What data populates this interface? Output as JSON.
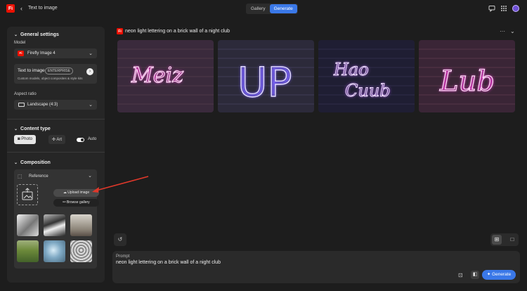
{
  "app": {
    "logo": "Fi",
    "back_glyph": "‹",
    "title": "Text to image",
    "tabs": [
      "Gallery",
      "Generate"
    ],
    "icons": [
      "chat-icon",
      "apps-grid-icon",
      "avatar"
    ]
  },
  "sidebar": {
    "general": {
      "heading": "General settings",
      "model_label": "Model",
      "model_value": "Firefly Image 4",
      "card_title": "Text to image",
      "card_badge": "ENTERPRISE",
      "card_desc": "Custom models, object composites & style kits",
      "aspect_label": "Aspect ratio",
      "aspect_value": "Landscape (4:3)"
    },
    "content_type": {
      "heading": "Content type",
      "options": [
        "Photo",
        "Art"
      ],
      "selected": "Photo",
      "auto_label": "Auto"
    },
    "composition": {
      "heading": "Composition",
      "reference_label": "Reference",
      "upload_label": "Upload image",
      "browse_label": "Browse gallery"
    }
  },
  "main": {
    "prompt_title": "neon light lettering on a brick wall of a night club",
    "images": [
      {
        "text": "Meiz",
        "color": "#ff3fd8"
      },
      {
        "text": "UP",
        "color": "#8a7bff"
      },
      {
        "text": "Hao Cuub",
        "color": "#c060ff"
      },
      {
        "text": "Lub",
        "color": "#ff4fe0"
      }
    ]
  },
  "prompt_bar": {
    "label": "Prompt",
    "value": "neon light lettering on a brick wall of a night club",
    "generate_label": "Generate"
  },
  "colors": {
    "accent": "#3a78e8",
    "brand": "#eb1000",
    "annotation_arrow": "#e0382a"
  }
}
